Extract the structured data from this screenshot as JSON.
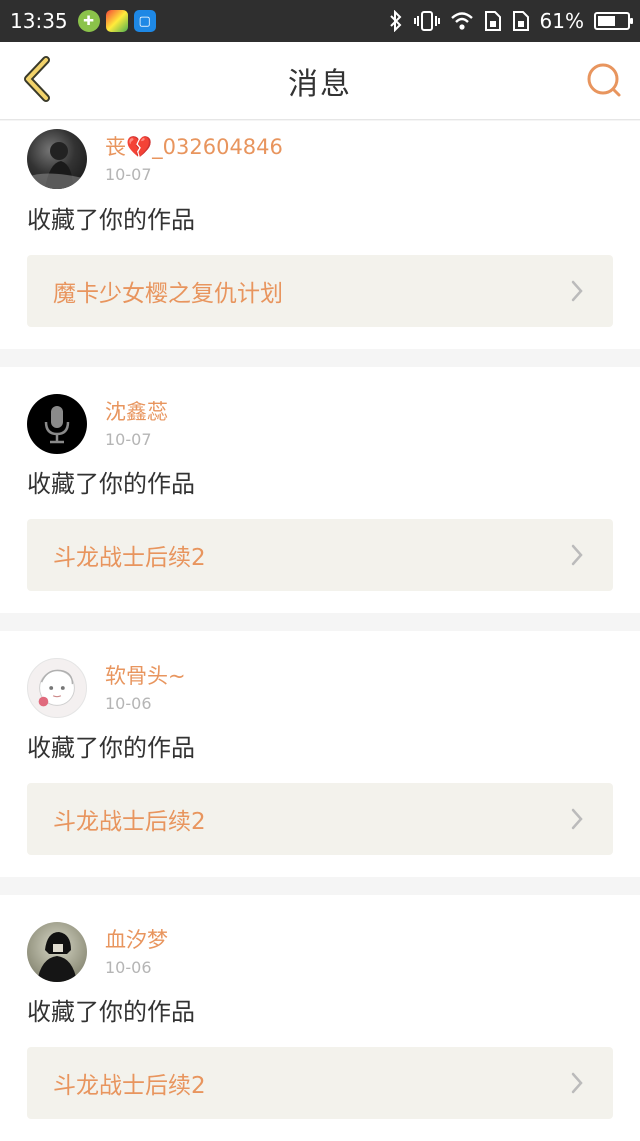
{
  "status_bar": {
    "time": "13:35",
    "battery_percent_text": "61%",
    "battery_level": 0.61
  },
  "nav": {
    "title": "消息",
    "back_icon": "chevron-left-icon",
    "search_icon": "search-icon",
    "accent_color": "#e8955e"
  },
  "messages": [
    {
      "username": "丧💔_032604846",
      "date": "10-07",
      "action": "收藏了你的作品",
      "work_title": "魔卡少女樱之复仇计划"
    },
    {
      "username": "沈鑫蕊",
      "date": "10-07",
      "action": "收藏了你的作品",
      "work_title": "斗龙战士后续2"
    },
    {
      "username": "软骨头~",
      "date": "10-06",
      "action": "收藏了你的作品",
      "work_title": "斗龙战士后续2"
    },
    {
      "username": "血汐梦",
      "date": "10-06",
      "action": "收藏了你的作品",
      "work_title": "斗龙战士后续2"
    }
  ]
}
